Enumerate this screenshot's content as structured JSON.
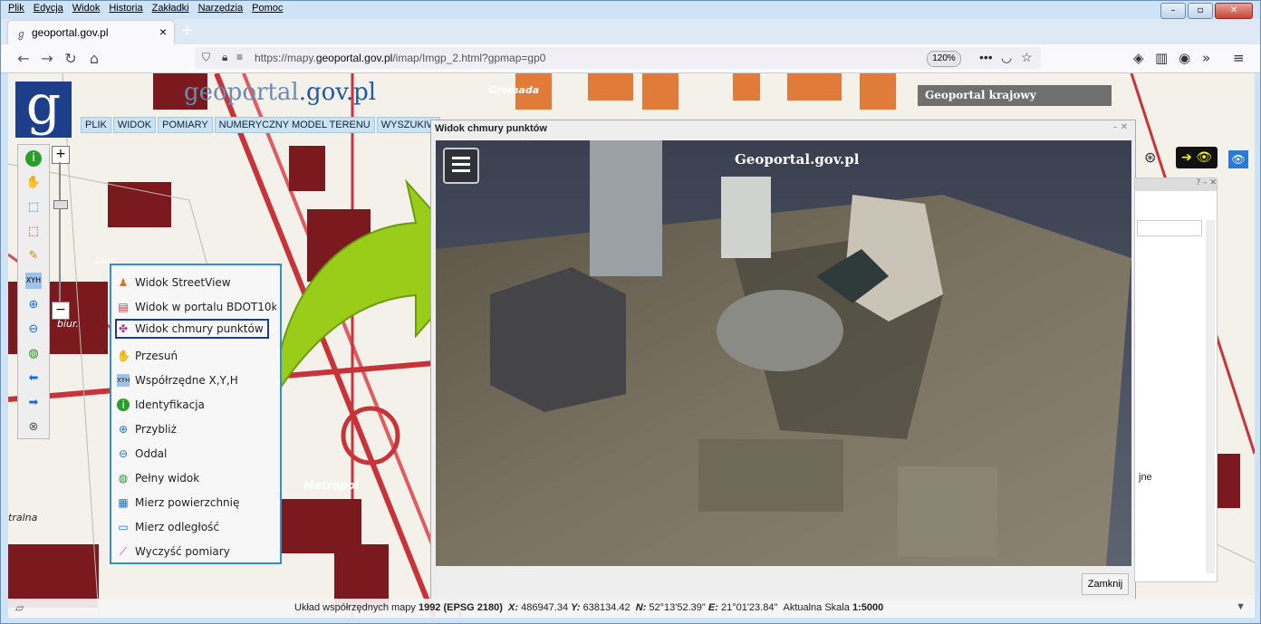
{
  "browser": {
    "menu": [
      "Plik",
      "Edycja",
      "Widok",
      "Historia",
      "Zakładki",
      "Narzędzia",
      "Pomoc"
    ],
    "tab_title": "geoportal.gov.pl",
    "url_prefix": "https://mapy.",
    "url_domain": "geoportal.gov.pl",
    "url_suffix": "/imap/Imgp_2.html?gpmap=gp0",
    "zoom": "120%"
  },
  "site": {
    "title_main": "geoportal",
    "title_domain": ".gov.pl",
    "menu": [
      "PLIK",
      "WIDOK",
      "POMIARY",
      "NUMERYCZNY MODEL TERENU",
      "WYSZUKIW"
    ],
    "banner": "Geoportal krajowy"
  },
  "map_labels": {
    "gromada": "Gromada",
    "metropol": "Metropol",
    "biur": "biur.",
    "biur2": "biur.",
    "tralna": "tralna"
  },
  "context_menu": [
    {
      "label": "Widok StreetView",
      "icon": "streetview-icon"
    },
    {
      "label": "Widok w portalu BDOT10k",
      "icon": "bdot-icon"
    },
    {
      "label": "Widok chmury punktów",
      "icon": "pointcloud-icon"
    },
    {
      "label": "Przesuń",
      "icon": "hand-icon"
    },
    {
      "label": "Współrzędne X,Y,H",
      "icon": "xyh-icon"
    },
    {
      "label": "Identyfikacja",
      "icon": "info-icon"
    },
    {
      "label": "Przybliż",
      "icon": "zoom-in-icon"
    },
    {
      "label": "Oddal",
      "icon": "zoom-out-icon"
    },
    {
      "label": "Pełny widok",
      "icon": "globe-icon"
    },
    {
      "label": "Mierz powierzchnię",
      "icon": "measure-area-icon"
    },
    {
      "label": "Mierz odległość",
      "icon": "measure-distance-icon"
    },
    {
      "label": "Wyczyść pomiary",
      "icon": "clear-measure-icon"
    }
  ],
  "popup": {
    "title": "Widok chmury punktów",
    "watermark": "Geoportal.gov.pl",
    "close_label": "Zamknij"
  },
  "right_panel": {
    "partial_text": "jne"
  },
  "status": {
    "prefix": "Układ współrzędnych mapy",
    "system": "1992 (EPSG 2180)",
    "x_label": "X:",
    "x": "486947.34",
    "y_label": "Y:",
    "y": "638134.42",
    "n_label": "N:",
    "n": "52°13'52.39\"",
    "e_label": "E:",
    "e": "21°01'23.84\"",
    "scale_label": "Aktualna Skala",
    "scale": "1:5000"
  }
}
